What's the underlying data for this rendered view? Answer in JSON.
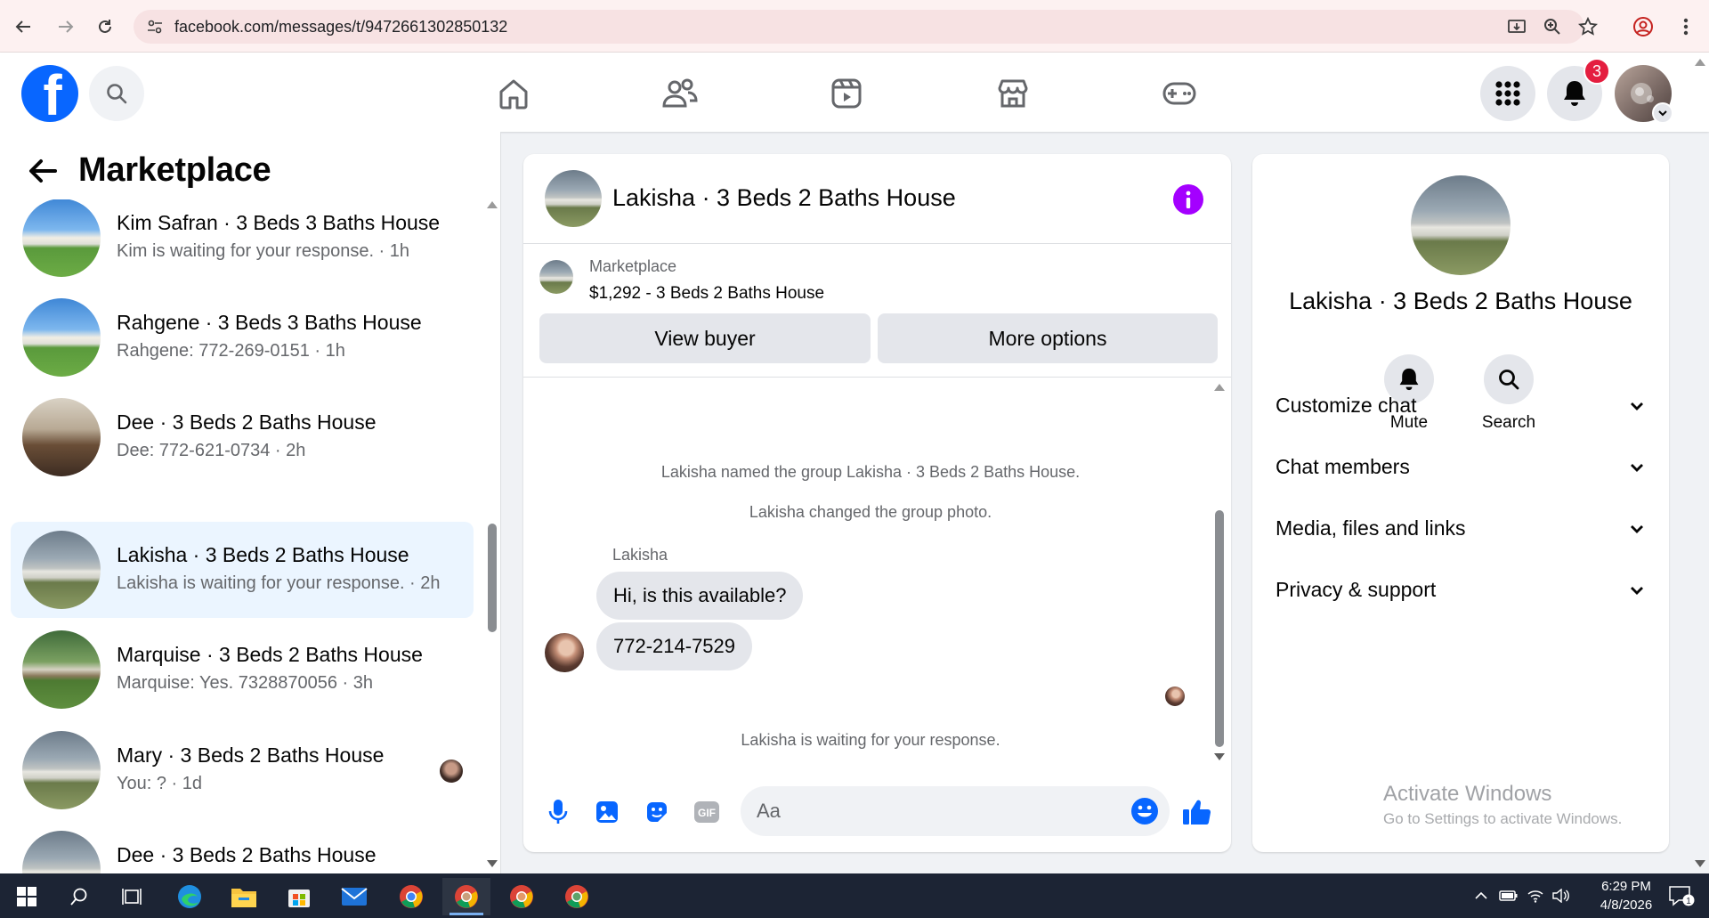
{
  "browser": {
    "url": "facebook.com/messages/t/9472661302850132"
  },
  "header": {
    "notification_count": "3"
  },
  "sidebar": {
    "title": "Marketplace",
    "conversations": [
      {
        "name": "Kim Safran · 3 Beds 3 Baths House",
        "preview": "Kim is waiting for your response. · 1h",
        "active": false
      },
      {
        "name": "Rahgene · 3 Beds 3 Baths House",
        "preview": "Rahgene: 772-269-0151 · 1h",
        "active": false
      },
      {
        "name": "Dee · 3 Beds 2 Baths House",
        "preview": "Dee: 772-621-0734 · 2h",
        "active": false
      },
      {
        "name": "Lakisha · 3 Beds 2 Baths House",
        "preview": "Lakisha is waiting for your response. · 2h",
        "active": true
      },
      {
        "name": "Marquise · 3 Beds 2 Baths House",
        "preview": "Marquise: Yes. 7328870056 · 3h",
        "active": false
      },
      {
        "name": "Mary · 3 Beds 2 Baths House",
        "preview": "You: ? · 1d",
        "active": false
      },
      {
        "name": "Dee · 3 Beds 2 Baths House",
        "preview": "",
        "active": false
      }
    ]
  },
  "chat": {
    "title": "Lakisha · 3 Beds 2 Baths House",
    "listing_category": "Marketplace",
    "listing_title": "$1,292 - 3 Beds 2 Baths House",
    "view_buyer_label": "View buyer",
    "more_options_label": "More options",
    "system_messages": [
      "Lakisha named the group Lakisha · 3 Beds 2 Baths House.",
      "Lakisha changed the group photo."
    ],
    "sender_name": "Lakisha",
    "messages": [
      "Hi, is this available?",
      "772-214-7529"
    ],
    "waiting_notice": "Lakisha is waiting for your response.",
    "composer_placeholder": "Aa"
  },
  "details": {
    "title": "Lakisha · 3 Beds 2 Baths House",
    "mute_label": "Mute",
    "search_label": "Search",
    "sections": [
      "Customize chat",
      "Chat members",
      "Media, files and links",
      "Privacy & support"
    ]
  },
  "watermark": {
    "line1": "Activate Windows",
    "line2": "Go to Settings to activate Windows."
  },
  "taskbar": {
    "time": "6:29 PM",
    "date": "4/8/2026",
    "notification_count": "1"
  },
  "colors": {
    "brand_blue": "#0866ff",
    "messenger_purple": "#a400ff",
    "active_row": "#ebf5ff",
    "badge_red": "#e41e3f"
  }
}
